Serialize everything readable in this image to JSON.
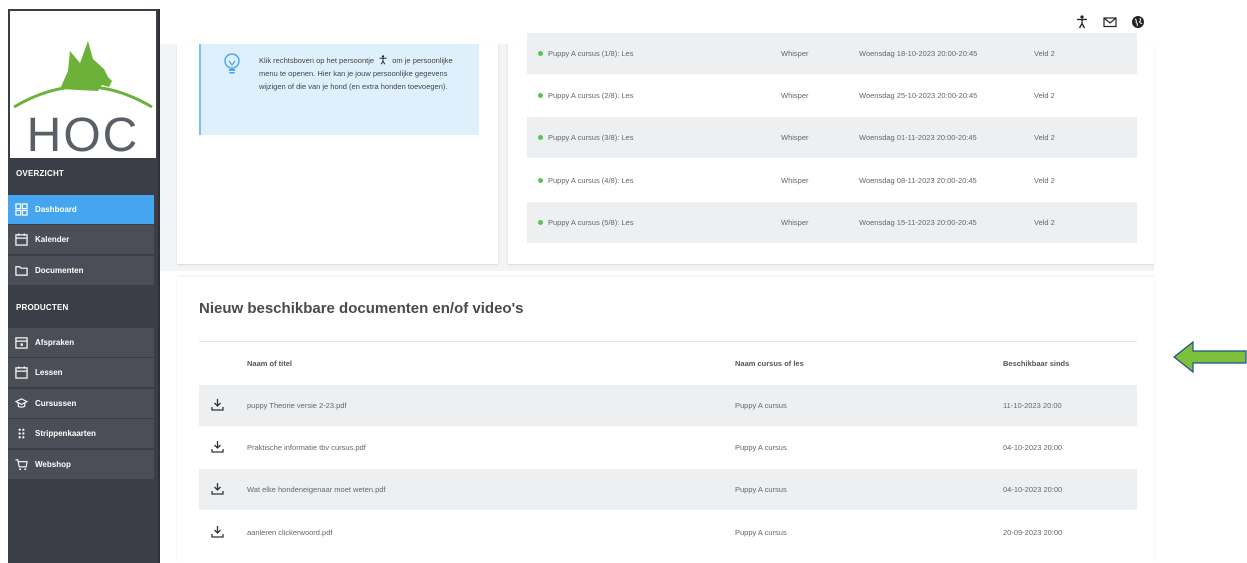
{
  "brand": {
    "logo_text": "HOC"
  },
  "sidebar": {
    "sections": [
      {
        "label": "OVERZICHT"
      },
      {
        "label": "PRODUCTEN"
      }
    ],
    "items": [
      {
        "label": "Dashboard",
        "icon": "dashboard-icon",
        "active": true
      },
      {
        "label": "Kalender",
        "icon": "calendar-icon"
      },
      {
        "label": "Documenten",
        "icon": "folder-icon"
      },
      {
        "label": "Afspraken",
        "icon": "calendar-plus-icon"
      },
      {
        "label": "Lessen",
        "icon": "calendar-icon"
      },
      {
        "label": "Cursussen",
        "icon": "graduation-cap-icon"
      },
      {
        "label": "Strippenkaarten",
        "icon": "dots-grid-icon"
      },
      {
        "label": "Webshop",
        "icon": "cart-icon"
      }
    ]
  },
  "topbar": {
    "icons": [
      "person-icon",
      "mail-icon",
      "globe-icon"
    ]
  },
  "info": {
    "text_before": "Klik rechtsboven op het persoontje",
    "text_after": "om je persoonlijke menu te openen. Hier kan je jouw persoonlijke gegevens wijzigen of die van je hond (en extra honden toevoegen)."
  },
  "lessons": [
    {
      "title": "Puppy A cursus (1/8): Les",
      "trainer": "Whisper",
      "date": "Woensdag 18-10-2023 20:00-20:45",
      "field": "Veld 2"
    },
    {
      "title": "Puppy A cursus (2/8): Les",
      "trainer": "Whisper",
      "date": "Woensdag 25-10-2023 20:00-20:45",
      "field": "Veld 2"
    },
    {
      "title": "Puppy A cursus (3/8): Les",
      "trainer": "Whisper",
      "date": "Woensdag 01-11-2023 20:00-20:45",
      "field": "Veld 2"
    },
    {
      "title": "Puppy A cursus (4/8): Les",
      "trainer": "Whisper",
      "date": "Woensdag 08-11-2023 20:00-20:45",
      "field": "Veld 2"
    },
    {
      "title": "Puppy A cursus (5/8): Les",
      "trainer": "Whisper",
      "date": "Woensdag 15-11-2023 20:00-20:45",
      "field": "Veld 2"
    }
  ],
  "documents": {
    "title": "Nieuw beschikbare documenten en/of video's",
    "headers": {
      "name": "Naam of titel",
      "course": "Naam cursus of les",
      "since": "Beschikbaar sinds"
    },
    "rows": [
      {
        "name": "puppy Theorie versie 2-23.pdf",
        "course": "Puppy A cursus",
        "since": "11-10-2023 20:00"
      },
      {
        "name": "Praktische informatie tbv cursus.pdf",
        "course": "Puppy A cursus",
        "since": "04-10-2023 20:00"
      },
      {
        "name": "Wat elke hondeneigenaar moet weten.pdf",
        "course": "Puppy A cursus",
        "since": "04-10-2023 20:00"
      },
      {
        "name": "aanleren clickerwoord.pdf",
        "course": "Puppy A cursus",
        "since": "20-09-2023 20:00"
      }
    ]
  },
  "colors": {
    "sidebar_bg": "#3b3e46",
    "nav_item_bg": "#4b4e56",
    "active": "#45a5ee",
    "info_bg": "#dff0fd",
    "status_dot": "#5cc15c",
    "arrow": "#7bbf3a"
  }
}
